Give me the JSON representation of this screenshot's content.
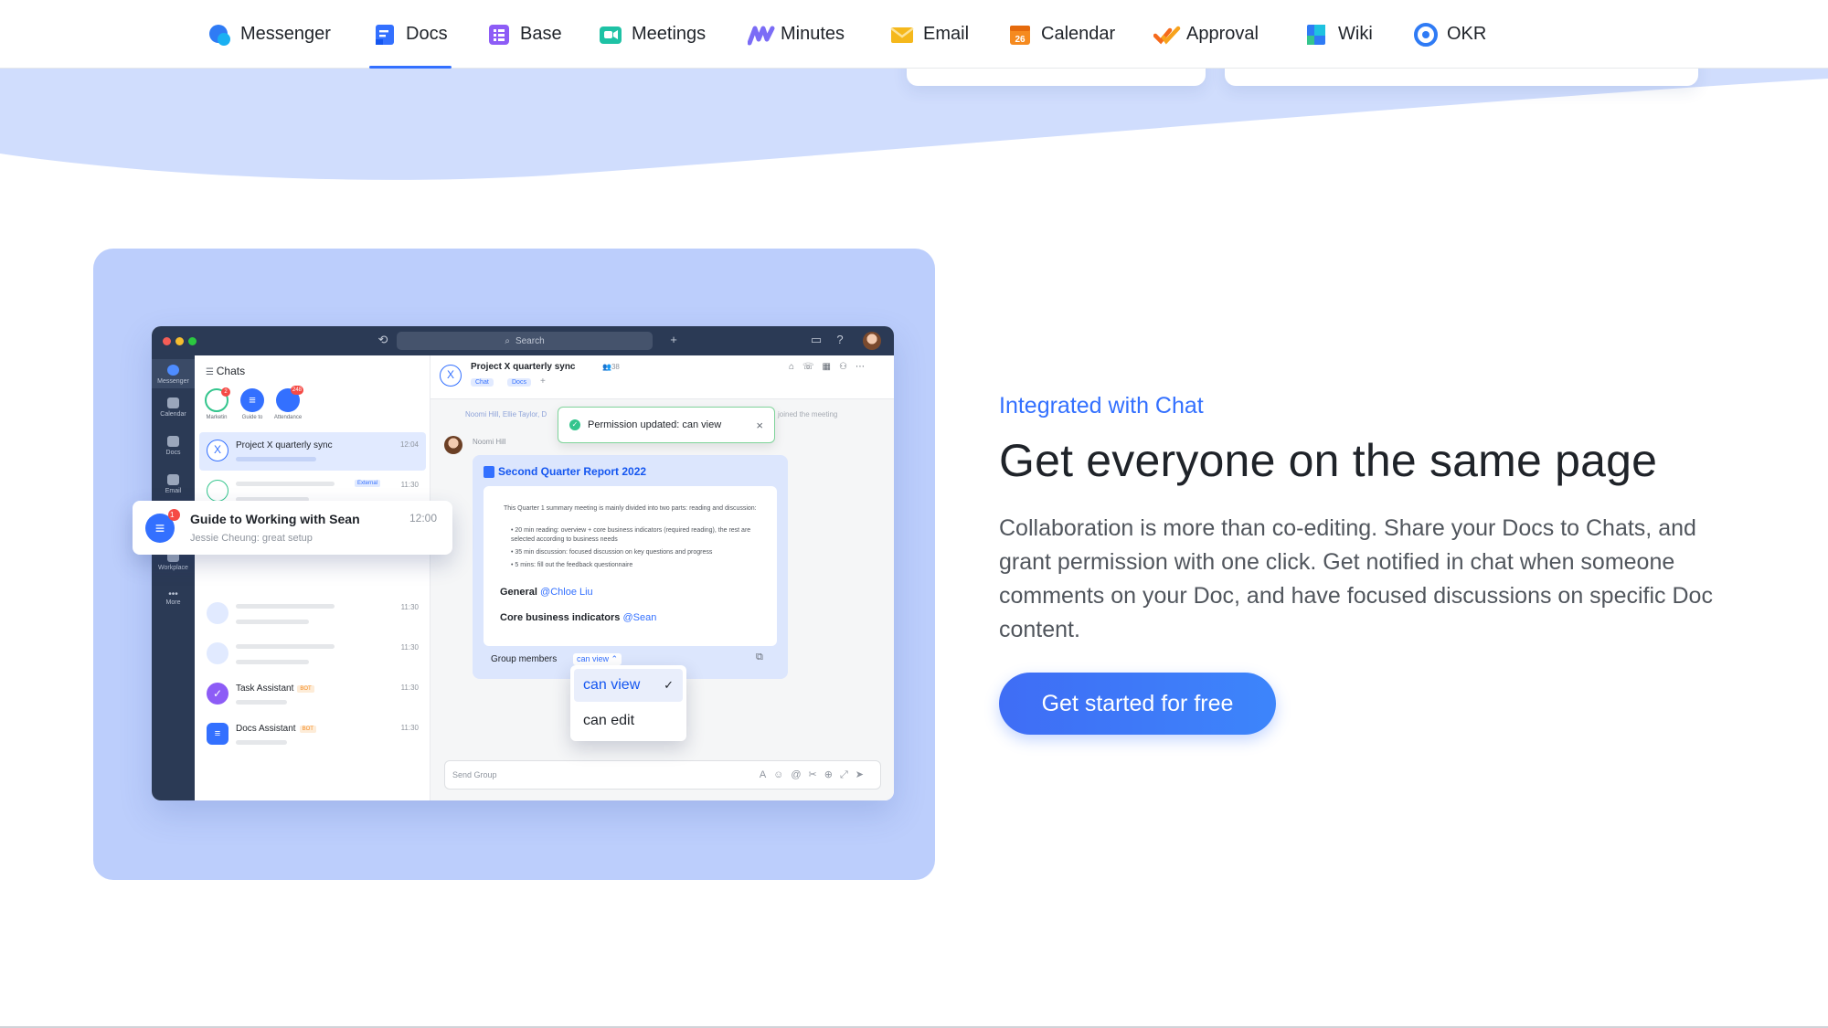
{
  "nav": {
    "items": [
      {
        "label": "Messenger",
        "icon": "messenger-icon"
      },
      {
        "label": "Docs",
        "icon": "docs-icon"
      },
      {
        "label": "Base",
        "icon": "base-icon"
      },
      {
        "label": "Meetings",
        "icon": "meetings-icon"
      },
      {
        "label": "Minutes",
        "icon": "minutes-icon"
      },
      {
        "label": "Email",
        "icon": "email-icon"
      },
      {
        "label": "Calendar",
        "icon": "calendar-icon",
        "icon_text": "26"
      },
      {
        "label": "Approval",
        "icon": "approval-icon"
      },
      {
        "label": "Wiki",
        "icon": "wiki-icon"
      },
      {
        "label": "OKR",
        "icon": "okr-icon"
      }
    ],
    "active": "Docs"
  },
  "app": {
    "search_placeholder": "Search",
    "rail": [
      {
        "label": "Messenger"
      },
      {
        "label": "Calendar"
      },
      {
        "label": "Docs"
      },
      {
        "label": "Email"
      },
      {
        "label": "Workplace"
      },
      {
        "label": "More"
      }
    ],
    "chats_title": "Chats",
    "pinned": [
      {
        "label": "Marketin",
        "badge": "2"
      },
      {
        "label": "Guide to",
        "badge": ""
      },
      {
        "label": "Attendance",
        "badge": "248"
      }
    ],
    "list": [
      {
        "name": "Project X quarterly sync",
        "time": "12:04"
      },
      {
        "name": "",
        "time": "11:30",
        "tag": "External"
      },
      {
        "name": "",
        "time": "11:30"
      },
      {
        "name": "",
        "time": "11:30"
      },
      {
        "name": "Task Assistant",
        "time": "11:30",
        "tag": "BOT"
      },
      {
        "name": "Docs Assistant",
        "time": "11:30",
        "tag": "BOT"
      }
    ],
    "float_card": {
      "title": "Guide to Working with Sean",
      "subtitle": "Jessie Cheung: great setup",
      "time": "12:00",
      "badge": "1"
    },
    "convo": {
      "title": "Project X quarterly sync",
      "member_count": "38",
      "tabs": [
        "Chat",
        "Docs"
      ],
      "system_names": "Noomi Hill, Ellie Taylor, D",
      "system_suffix": "joined the meeting",
      "sender": "Noomi Hill",
      "toast": "Permission updated: can view",
      "doc_title": "Second Quarter Report 2022",
      "doc_intro": "This Quarter 1 summary meeting is mainly divided into two parts: reading and discussion:",
      "doc_bullets": [
        "20 min reading: overview + core business indicators (required reading), the rest are selected according to business needs",
        "35 min discussion: focused discussion on key questions and progress",
        "5 mins: fill out the feedback questionnaire"
      ],
      "general_label": "General",
      "general_mention": "@Chloe Liu",
      "core_label": "Core business indicators",
      "core_mention": "@Sean",
      "group_members_label": "Group members",
      "permission_value": "can view",
      "dropdown_options": [
        "can view",
        "can edit"
      ],
      "input_placeholder": "Send Group"
    }
  },
  "section": {
    "eyebrow": "Integrated with Chat",
    "headline": "Get everyone on the same page",
    "body": "Collaboration is more than co-editing. Share your Docs to Chats, and grant permission with one click. Get notified in chat when someone comments on your Doc, and have focused discussions on specific Doc content.",
    "cta": "Get started for free"
  },
  "colors": {
    "accent": "#3370ff",
    "panel_bg": "#bccefc",
    "hero_wave": "#d0ddfd",
    "app_dark": "#2b3a55"
  }
}
